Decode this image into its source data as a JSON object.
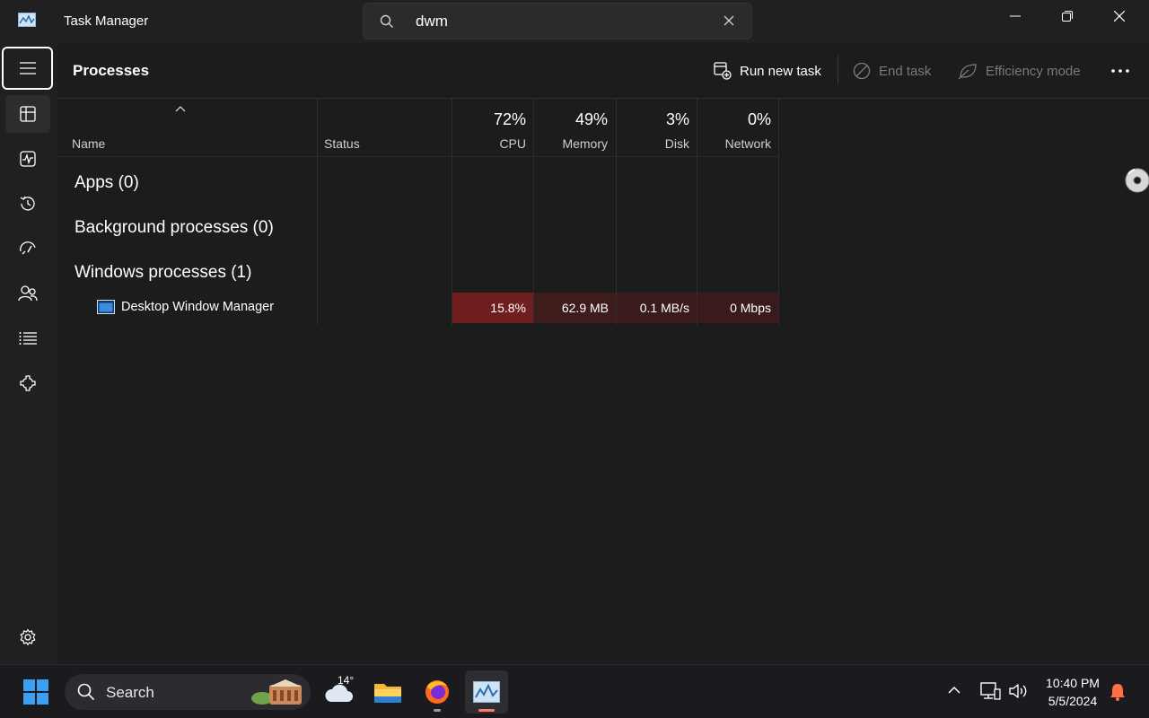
{
  "app": {
    "title": "Task Manager"
  },
  "search": {
    "value": "dwm"
  },
  "header": {
    "title": "Processes",
    "run_new_task": "Run new task",
    "end_task": "End task",
    "efficiency_mode": "Efficiency mode"
  },
  "columns": {
    "name": "Name",
    "status": "Status",
    "cpu": {
      "pct": "72%",
      "label": "CPU"
    },
    "memory": {
      "pct": "49%",
      "label": "Memory"
    },
    "disk": {
      "pct": "3%",
      "label": "Disk"
    },
    "network": {
      "pct": "0%",
      "label": "Network"
    }
  },
  "groups": {
    "apps": "Apps (0)",
    "background": "Background processes (0)",
    "windows": "Windows processes (1)"
  },
  "process": {
    "name": "Desktop Window Manager",
    "cpu": "15.8%",
    "memory": "62.9 MB",
    "disk": "0.1 MB/s",
    "network": "0 Mbps"
  },
  "colors": {
    "cpu_heat": "#6f1e1e",
    "mem_heat": "#3f1c1c",
    "disk_heat": "#3a1a1a",
    "net_heat": "#3a1a1a",
    "accent": "#ff7a66"
  },
  "taskbar": {
    "search_label": "Search",
    "weather_temp": "14°",
    "clock_time": "10:40 PM",
    "clock_date": "5/5/2024"
  }
}
